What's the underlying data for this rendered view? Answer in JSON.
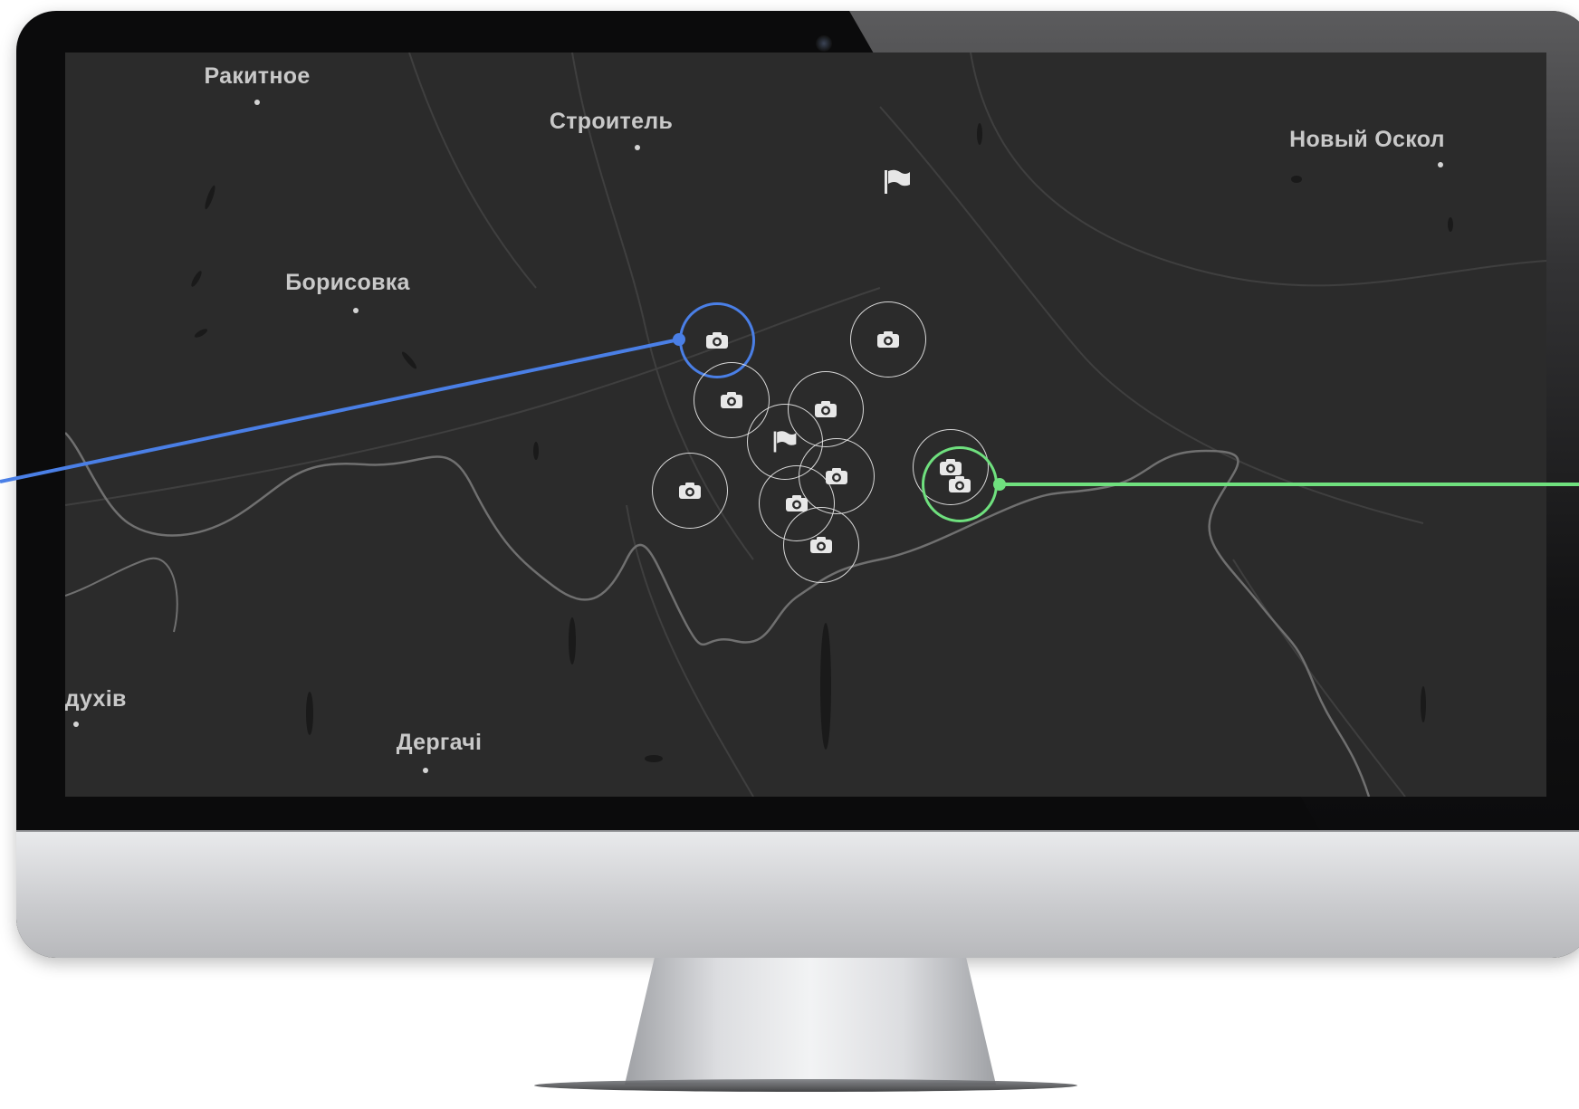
{
  "map": {
    "cities": [
      {
        "id": "rakitnoe",
        "label": "Ракитное"
      },
      {
        "id": "stroitel",
        "label": "Строитель"
      },
      {
        "id": "novyi-oskol",
        "label": "Новый Оскол"
      },
      {
        "id": "borisovka",
        "label": "Борисовка"
      },
      {
        "id": "bohodukhiv",
        "label": "одухів"
      },
      {
        "id": "derhachi",
        "label": "Дергачі"
      }
    ],
    "markers": [
      {
        "type": "camera",
        "state": "selected-blue"
      },
      {
        "type": "camera",
        "state": "default"
      },
      {
        "type": "camera",
        "state": "default"
      },
      {
        "type": "camera",
        "state": "default"
      },
      {
        "type": "flag",
        "state": "default"
      },
      {
        "type": "camera",
        "state": "default"
      },
      {
        "type": "camera",
        "state": "default"
      },
      {
        "type": "camera",
        "state": "default"
      },
      {
        "type": "camera",
        "state": "default"
      },
      {
        "type": "camera-cluster",
        "state": "default"
      },
      {
        "type": "camera",
        "state": "selected-green"
      }
    ],
    "standalone_flag": {
      "type": "flag"
    },
    "colors": {
      "background": "#2b2b2b",
      "road": "#4a4a4a",
      "border": "#6f6f6f",
      "label": "#c9c9c9",
      "accent_blue": "#4a7fe6",
      "accent_green": "#6fe07e"
    },
    "icons": {
      "camera": "camera-icon",
      "flag": "flag-icon"
    }
  }
}
